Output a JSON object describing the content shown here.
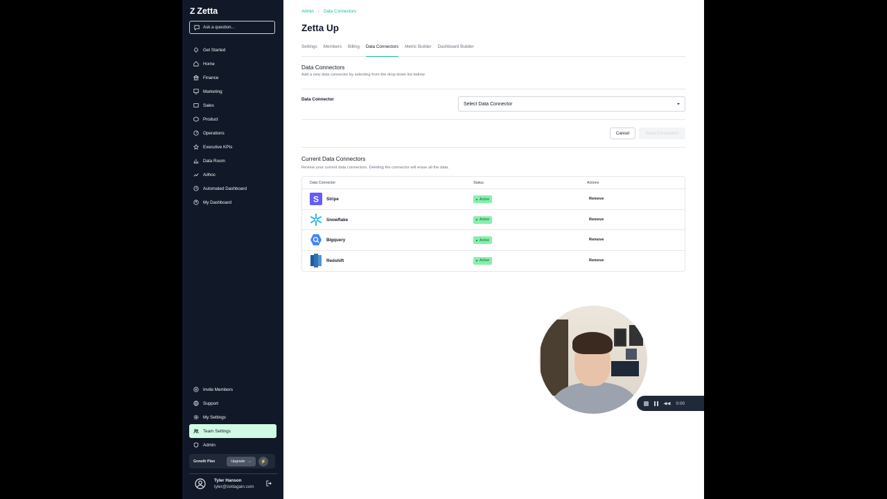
{
  "app": {
    "name": "Zetta"
  },
  "search": {
    "placeholder": "Ask a question..."
  },
  "sidebar": {
    "items": [
      {
        "label": "Get Started",
        "icon": "rocket-icon"
      },
      {
        "label": "Home",
        "icon": "home-icon"
      },
      {
        "label": "Finance",
        "icon": "bank-icon"
      },
      {
        "label": "Marketing",
        "icon": "monitor-icon"
      },
      {
        "label": "Sales",
        "icon": "tag-icon"
      },
      {
        "label": "Product",
        "icon": "box-icon"
      },
      {
        "label": "Operations",
        "icon": "gauge-icon"
      },
      {
        "label": "Executive KPIs",
        "icon": "star-icon"
      },
      {
        "label": "Data Room",
        "icon": "bar-chart-icon"
      },
      {
        "label": "Adhoc",
        "icon": "trend-icon"
      },
      {
        "label": "Automated Dashboard",
        "icon": "clock-icon"
      },
      {
        "label": "My Dashboard",
        "icon": "user-circle-icon"
      }
    ],
    "bottom_items": [
      {
        "label": "Invite Members",
        "icon": "plus-circle-icon"
      },
      {
        "label": "Support",
        "icon": "globe-icon"
      },
      {
        "label": "My Settings",
        "icon": "gear-icon"
      },
      {
        "label": "Team Settings",
        "icon": "team-icon"
      },
      {
        "label": "Admin",
        "icon": "shield-icon"
      }
    ],
    "active_item": "Team Settings",
    "plan": {
      "label": "Growth Plan",
      "upgrade": "Upgrade"
    },
    "user": {
      "name": "Tyler Hanson",
      "email": "tyler@zettagain.com"
    }
  },
  "breadcrumb": {
    "root": "Admin",
    "current": "Data Connectors"
  },
  "page": {
    "title": "Zetta Up"
  },
  "tabs": [
    "Settings",
    "Members",
    "Billing",
    "Data Connectors",
    "Metric Builder",
    "Dashboard Builder"
  ],
  "active_tab": "Data Connectors",
  "add_section": {
    "title": "Data Connectors",
    "subtitle": "Add a new data connector by selecting from the drop down list bellow",
    "field_label": "Data Connector",
    "select_value": "Select Data Connector",
    "cancel": "Cancel",
    "save": "Save Connection"
  },
  "current_section": {
    "title": "Current Data Connectors",
    "subtitle": "Review your current data connectors. Deleting the connector will erase all the data.",
    "columns": [
      "Data Connector",
      "Status",
      "Actions"
    ],
    "rows": [
      {
        "name": "Stripe",
        "status": "Active",
        "action": "Remove",
        "icon": "stripe-icon"
      },
      {
        "name": "Snowflake",
        "status": "Active",
        "action": "Remove",
        "icon": "snowflake-icon"
      },
      {
        "name": "Bigquery",
        "status": "Active",
        "action": "Remove",
        "icon": "bigquery-icon"
      },
      {
        "name": "Redshift",
        "status": "Active",
        "action": "Remove",
        "icon": "redshift-icon"
      }
    ]
  },
  "recorder": {
    "time": "0:00"
  },
  "colors": {
    "sidebar_bg": "#111827",
    "accent": "#14b8a6",
    "active_bg": "#d1fae5",
    "badge_bg": "#86efac"
  }
}
